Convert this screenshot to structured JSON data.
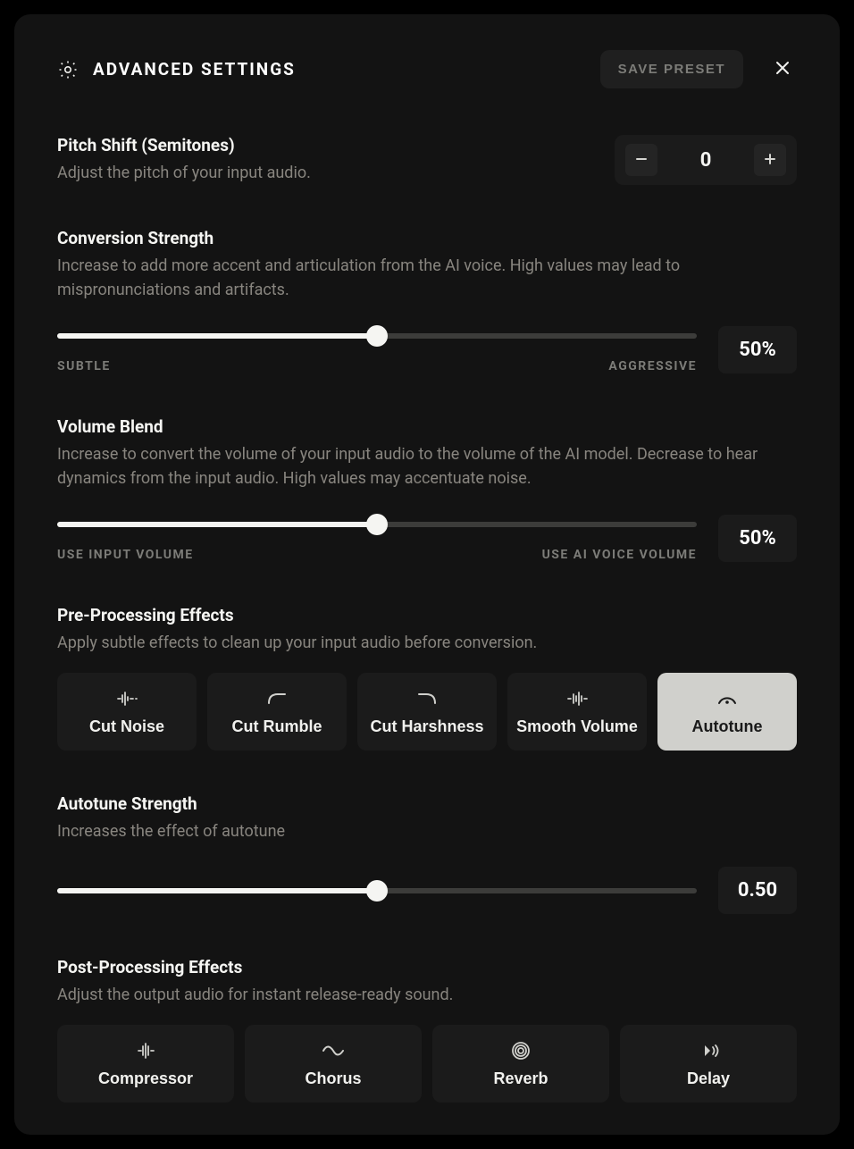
{
  "header": {
    "title": "ADVANCED SETTINGS",
    "save_preset": "SAVE PRESET"
  },
  "pitch": {
    "title": "Pitch Shift (Semitones)",
    "desc": "Adjust the pitch of your input audio.",
    "value": "0"
  },
  "conversion": {
    "title": "Conversion Strength",
    "desc": "Increase to add more accent and articulation from the AI voice. High values may lead to mispronunciations and artifacts.",
    "left_label": "SUBTLE",
    "right_label": "AGGRESSIVE",
    "value_display": "50%",
    "percent": 50
  },
  "volume": {
    "title": "Volume Blend",
    "desc": "Increase to convert the volume of your input audio to the volume of the AI model. Decrease to hear dynamics from the input audio. High values may accentuate noise.",
    "left_label": "USE INPUT VOLUME",
    "right_label": "USE AI VOICE VOLUME",
    "value_display": "50%",
    "percent": 50
  },
  "pre_effects": {
    "title": "Pre-Processing Effects",
    "desc": "Apply subtle effects to clean up your input audio before conversion.",
    "items": [
      {
        "label": "Cut Noise",
        "active": false
      },
      {
        "label": "Cut Rumble",
        "active": false
      },
      {
        "label": "Cut Harshness",
        "active": false
      },
      {
        "label": "Smooth Volume",
        "active": false
      },
      {
        "label": "Autotune",
        "active": true
      }
    ]
  },
  "autotune": {
    "title": "Autotune Strength",
    "desc": "Increases the effect of autotune",
    "value_display": "0.50",
    "percent": 50
  },
  "post_effects": {
    "title": "Post-Processing Effects",
    "desc": "Adjust the output audio for instant release-ready sound.",
    "items": [
      {
        "label": "Compressor"
      },
      {
        "label": "Chorus"
      },
      {
        "label": "Reverb"
      },
      {
        "label": "Delay"
      }
    ]
  }
}
